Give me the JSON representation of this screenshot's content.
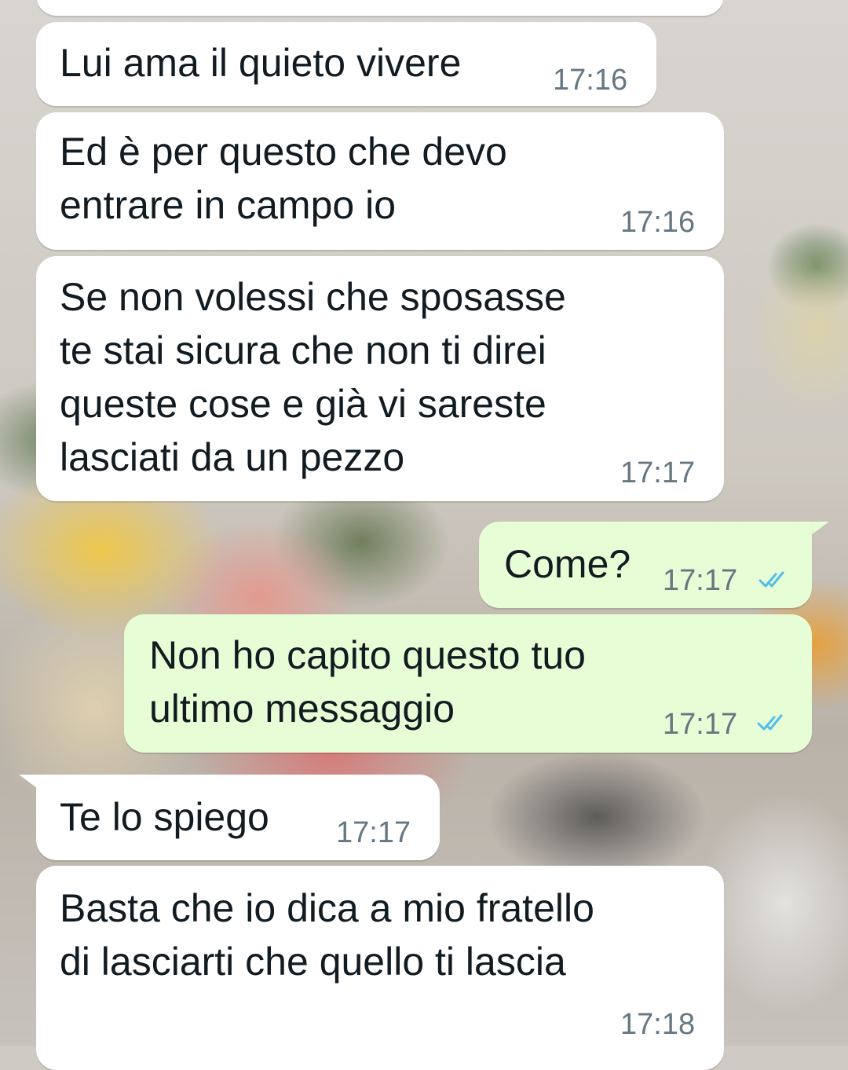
{
  "chat": {
    "messages": [
      {
        "direction": "incoming",
        "text": "",
        "time": ""
      },
      {
        "direction": "incoming",
        "text": "Lui ama il quieto vivere",
        "time": "17:16"
      },
      {
        "direction": "incoming",
        "text": "Ed è per questo che devo\nentrare in campo io",
        "time": "17:16"
      },
      {
        "direction": "incoming",
        "text": "Se non volessi che sposasse\nte stai sicura che non ti direi\nqueste cose e già vi sareste\nlasciati da un pezzo",
        "time": "17:17"
      },
      {
        "direction": "outgoing",
        "text": "Come?",
        "time": "17:17",
        "status_icon": "double-check-icon"
      },
      {
        "direction": "outgoing",
        "text": "Non ho capito questo tuo\nultimo messaggio",
        "time": "17:17",
        "status_icon": "double-check-icon"
      },
      {
        "direction": "incoming",
        "text": "Te lo spiego",
        "time": "17:17"
      },
      {
        "direction": "incoming",
        "text": "Basta che io dica a mio fratello\ndi lasciarti che quello ti lascia",
        "time": "17:18"
      }
    ]
  },
  "colors": {
    "incoming_bubble": "#ffffff",
    "outgoing_bubble": "#e7fdd5",
    "text": "#111b21",
    "time": "#667781",
    "read_check": "#53bdeb"
  }
}
